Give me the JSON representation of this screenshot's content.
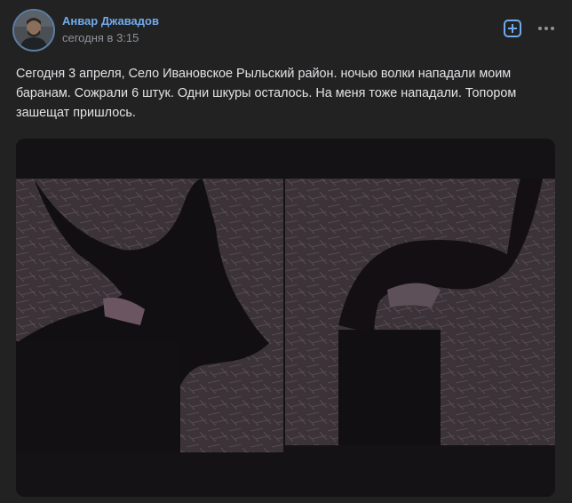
{
  "post": {
    "author": "Анвар Джавадов",
    "date": "сегодня в 3:15",
    "text": "Сегодня 3 апреля, Село Ивановское Рыльский район. ночью волки нападали моим баранам. Сожрали 6 штук. Одни шкуры осталось. На меня тоже нападали. Топором зашещат пришлось."
  },
  "icons": {
    "avatar": "avatar-photo",
    "add": "add-square-icon",
    "more": "more-horizontal-icon"
  },
  "colors": {
    "background": "#222222",
    "author_link": "#71aaeb",
    "secondary_text": "#8e9399",
    "primary_text": "#e1e3e6"
  }
}
